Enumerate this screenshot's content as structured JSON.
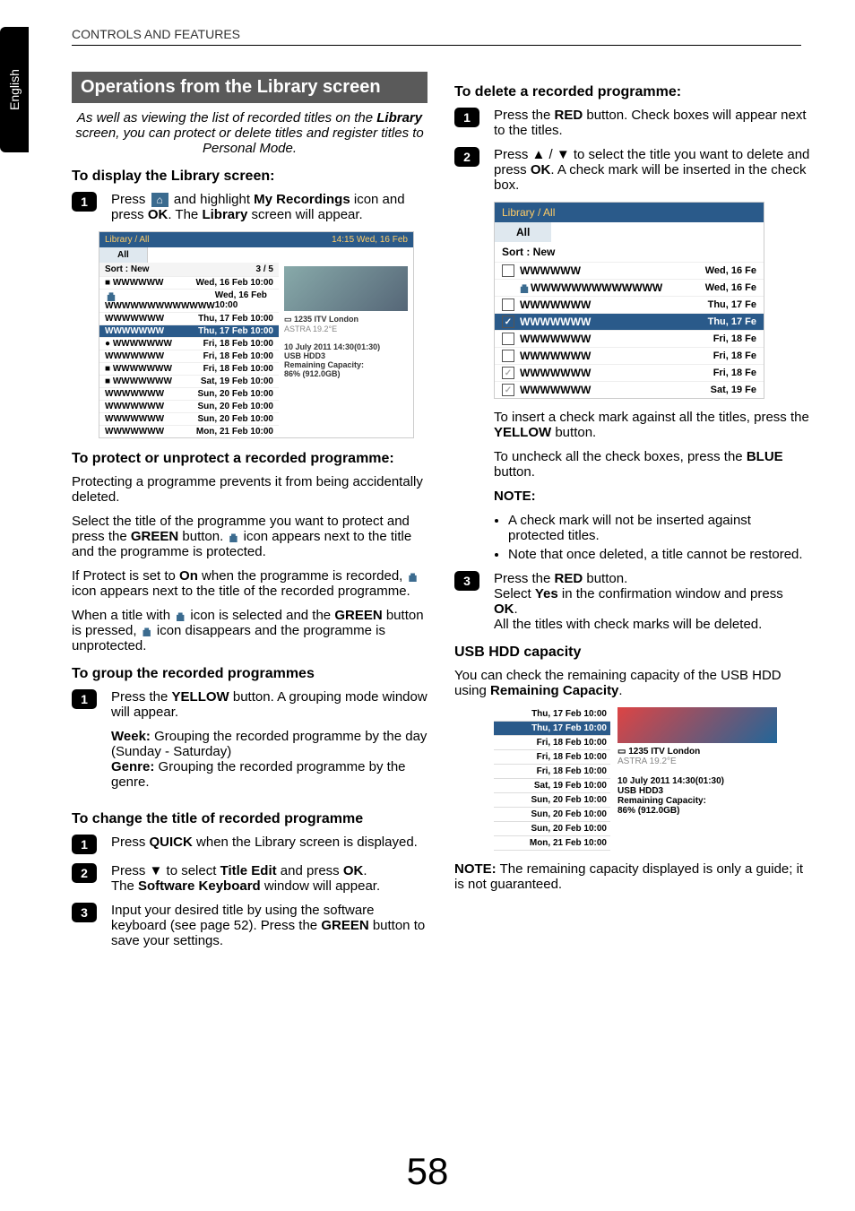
{
  "doc": {
    "header": "CONTROLS AND FEATURES",
    "lang_tab": "English",
    "page_number": "58"
  },
  "section_title": "Operations from the Library screen",
  "intro": {
    "a": "As well as viewing the list of recorded titles on the ",
    "b": "Library",
    "c": " screen, you can protect or delete titles and register titles to Personal Mode."
  },
  "display": {
    "heading": "To display the Library screen:",
    "step1a": "Press ",
    "step1b": " and highlight ",
    "step1c": "My Recordings",
    "step1d": " icon and press ",
    "step1e": "OK",
    "step1f": ". The ",
    "step1g": "Library",
    "step1h": " screen will appear."
  },
  "shot1": {
    "title": "Library / All",
    "clock": "14:15 Wed, 16 Feb",
    "tab_all": "All",
    "sort": "Sort : New",
    "counter": "3 / 5",
    "rows": [
      {
        "t": "WWWWWW",
        "d": "Wed, 16 Feb 10:00",
        "ic": "■"
      },
      {
        "t": "WWWWWWWWWWWWW",
        "d": "Wed, 16 Feb 10:00",
        "ic": "lock"
      },
      {
        "t": "WWWWWWW",
        "d": "Thu, 17 Feb 10:00",
        "ic": ""
      },
      {
        "t": "WWWWWWW",
        "d": "Thu, 17 Feb 10:00",
        "ic": "",
        "sel": true
      },
      {
        "t": "WWWWWWW",
        "d": "Fri, 18 Feb 10:00",
        "ic": "●"
      },
      {
        "t": "WWWWWWW",
        "d": "Fri, 18 Feb 10:00",
        "ic": ""
      },
      {
        "t": "WWWWWWW",
        "d": "Fri, 18 Feb 10:00",
        "ic": "■"
      },
      {
        "t": "WWWWWWW",
        "d": "Sat, 19 Feb 10:00",
        "ic": "■"
      },
      {
        "t": "WWWWWWW",
        "d": "Sun, 20 Feb 10:00",
        "ic": ""
      },
      {
        "t": "WWWWWWW",
        "d": "Sun, 20 Feb 10:00",
        "ic": ""
      },
      {
        "t": "WWWWWWW",
        "d": "Sun, 20 Feb 10:00",
        "ic": ""
      },
      {
        "t": "WWWWWWW",
        "d": "Mon, 21 Feb 10:00",
        "ic": ""
      }
    ],
    "chan": "1235 ITV London",
    "sat": "ASTRA 19.2°E",
    "dt": "10 July 2011  14:30(01:30)",
    "dev": "USB HDD3",
    "cap_l": "Remaining Capacity:",
    "cap_v": "86% (912.0GB)"
  },
  "protect": {
    "heading": "To protect or unprotect a recorded programme:",
    "p1": "Protecting a programme prevents it from being accidentally deleted.",
    "p2a": "Select the title of the programme you want to protect and press the ",
    "p2b": "GREEN",
    "p2c": " button. ",
    "p2d": " icon appears next to the title and the programme is protected.",
    "p3a": "If Protect is set to ",
    "p3b": "On",
    "p3c": " when the programme is recorded, ",
    "p3d": " icon appears next to the title of the recorded programme.",
    "p4a": "When a title with ",
    "p4b": " icon is selected and the ",
    "p4c": "GREEN",
    "p4d": " button is pressed, ",
    "p4e": " icon disappears and the programme is unprotected."
  },
  "group": {
    "heading": "To group the recorded programmes",
    "s1a": "Press the ",
    "s1b": "YELLOW",
    "s1c": " button. A grouping mode window will appear.",
    "week_l": "Week:",
    "week_t": " Grouping the recorded programme by the day (Sunday - Saturday)",
    "genre_l": "Genre:",
    "genre_t": " Grouping the recorded programme by the genre."
  },
  "rename": {
    "heading": "To change the title of recorded programme",
    "s1a": "Press ",
    "s1b": "QUICK",
    "s1c": " when the Library screen is displayed.",
    "s2a": "Press ▼ to select ",
    "s2b": "Title Edit",
    "s2c": " and press ",
    "s2d": "OK",
    "s2e": ".",
    "s2f": "The ",
    "s2g": "Software Keyboard",
    "s2h": " window will appear.",
    "s3a": "Input your desired title by using the software keyboard (see page 52). Press the ",
    "s3b": "GREEN",
    "s3c": " button to save your settings."
  },
  "delete": {
    "heading": "To delete a recorded programme:",
    "s1a": "Press the ",
    "s1b": "RED",
    "s1c": " button. Check boxes will appear next to the titles.",
    "s2a": "Press ▲ / ▼ to select the title you want to delete and press ",
    "s2b": "OK",
    "s2c": ". A check mark will be inserted in the check box.",
    "shot": {
      "title": "Library / All",
      "tab_all": "All",
      "sort": "Sort : New",
      "rows": [
        {
          "cb": "",
          "lk": "",
          "t": "WWWWWW",
          "d": "Wed, 16 Fe"
        },
        {
          "cb": "none",
          "lk": "lock",
          "t": "WWWWWWWWWWWWW",
          "d": "Wed, 16 Fe"
        },
        {
          "cb": "",
          "lk": "",
          "t": "WWWWWWW",
          "d": "Thu, 17 Fe"
        },
        {
          "cb": "✓",
          "lk": "",
          "t": "WWWWWWW",
          "d": "Thu, 17 Fe",
          "sel": true
        },
        {
          "cb": "",
          "lk": "",
          "t": "WWWWWWW",
          "d": "Fri, 18 Fe"
        },
        {
          "cb": "",
          "lk": "",
          "t": "WWWWWWW",
          "d": "Fri, 18 Fe"
        },
        {
          "cb": "dis",
          "lk": "",
          "t": "WWWWWWW",
          "d": "Fri, 18 Fe"
        },
        {
          "cb": "dis",
          "lk": "",
          "t": "WWWWWWW",
          "d": "Sat, 19 Fe"
        }
      ]
    },
    "after_a": "To insert a check mark against all the titles, press the ",
    "after_b": "YELLOW",
    "after_c": " button.",
    "after_d": "To uncheck all the check boxes, press the ",
    "after_e": "BLUE",
    "after_f": " button.",
    "note_l": "NOTE:",
    "note1": "A check mark will not be inserted against protected titles.",
    "note2": "Note that once deleted, a title cannot be restored.",
    "s3a": "Press the ",
    "s3b": "RED",
    "s3c": " button.",
    "s3d": "Select ",
    "s3e": "Yes",
    "s3f": " in the confirmation window and press ",
    "s3g": "OK",
    "s3h": ".",
    "s3i": "All the titles with check marks will be deleted."
  },
  "capacity": {
    "heading": "USB HDD capacity",
    "p1a": "You can check the remaining capacity of the USB HDD using ",
    "p1b": "Remaining Capacity",
    "p1c": ".",
    "dates": [
      {
        "d": "Thu, 17 Feb 10:00"
      },
      {
        "d": "Thu, 17 Feb 10:00",
        "sel": true
      },
      {
        "d": "Fri, 18 Feb 10:00"
      },
      {
        "d": "Fri, 18 Feb 10:00"
      },
      {
        "d": "Fri, 18 Feb 10:00"
      },
      {
        "d": "Sat, 19 Feb 10:00"
      },
      {
        "d": "Sun, 20 Feb 10:00"
      },
      {
        "d": "Sun, 20 Feb 10:00"
      },
      {
        "d": "Sun, 20 Feb 10:00"
      },
      {
        "d": "Mon, 21 Feb 10:00"
      }
    ],
    "chan": "1235 ITV London",
    "sat": "ASTRA 19.2°E",
    "dt": "10 July 2011  14:30(01:30)",
    "dev": "USB HDD3",
    "cap_l": "Remaining Capacity:",
    "cap_v": "86% (912.0GB)",
    "note_l": "NOTE:",
    "note_t": " The remaining capacity displayed is only a guide; it is not guaranteed."
  }
}
